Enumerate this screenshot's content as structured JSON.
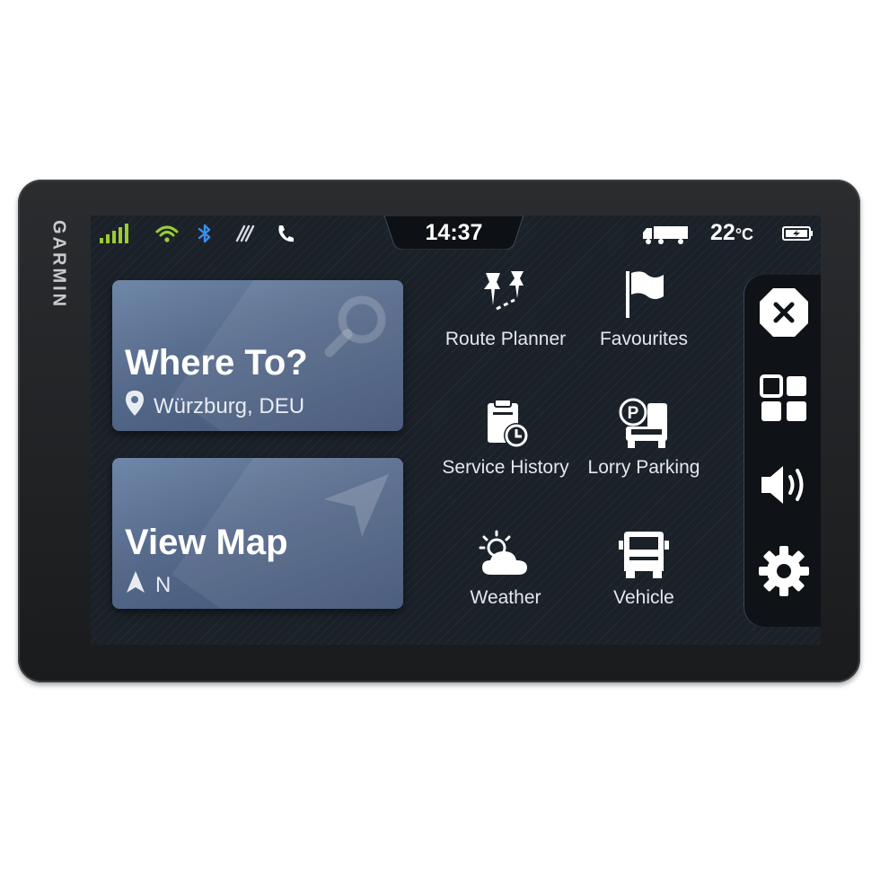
{
  "brand": "GARMIN",
  "status": {
    "time": "14:37",
    "temperature": "22",
    "temperature_unit": "°C",
    "icons": [
      "signal-bars-icon",
      "wifi-icon",
      "bluetooth-icon",
      "drive-app-icon",
      "phone-icon",
      "truck-icon",
      "battery-icon"
    ]
  },
  "cards": {
    "where_to": {
      "title": "Where To?",
      "subtitle": "Würzburg, DEU",
      "icon": "search-icon"
    },
    "view_map": {
      "title": "View Map",
      "subtitle": "N",
      "icon": "navigation-arrow-icon"
    }
  },
  "menu": [
    {
      "label": "Route Planner",
      "icon": "route-planner-icon"
    },
    {
      "label": "Favourites",
      "icon": "flag-icon"
    },
    {
      "label": "Service History",
      "icon": "service-history-icon"
    },
    {
      "label": "Lorry Parking",
      "icon": "lorry-parking-icon"
    },
    {
      "label": "Weather",
      "icon": "weather-icon"
    },
    {
      "label": "Vehicle",
      "icon": "vehicle-icon"
    }
  ],
  "side_panel": [
    "close-icon",
    "apps-grid-icon",
    "volume-icon",
    "settings-icon"
  ],
  "colors": {
    "screen_bg": "#1b2129",
    "card_accent": "#5b7193",
    "signal_green": "#9acd32",
    "bluetooth_blue": "#3b8ee8"
  }
}
